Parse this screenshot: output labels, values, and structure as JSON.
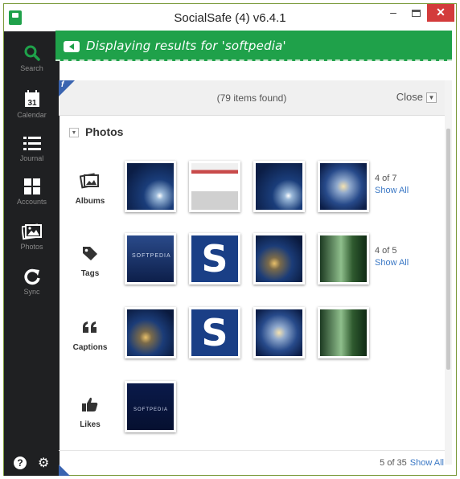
{
  "window": {
    "title": "SocialSafe (4) v6.4.1",
    "min_glyph": "–",
    "close_glyph": "✕"
  },
  "sidebar": {
    "items": [
      {
        "label": "Search",
        "icon": "search-icon",
        "color": "#1fa14a"
      },
      {
        "label": "Calendar",
        "icon": "calendar-icon",
        "day": "31"
      },
      {
        "label": "Journal",
        "icon": "list-icon"
      },
      {
        "label": "Accounts",
        "icon": "grid-icon"
      },
      {
        "label": "Photos",
        "icon": "photos-icon"
      },
      {
        "label": "Sync",
        "icon": "sync-icon"
      }
    ],
    "help_glyph": "?",
    "settings_glyph": "⚙"
  },
  "banner": {
    "text": "Displaying results for 'softpedia'",
    "color": "#1fa14a"
  },
  "results": {
    "items_found": "(79 items found)",
    "close_label": "Close",
    "fb_glyph": "f"
  },
  "photos": {
    "section_title": "Photos",
    "rows": [
      {
        "label": "Albums",
        "count": "4 of 7",
        "show_all": "Show All"
      },
      {
        "label": "Tags",
        "count": "4 of 5",
        "show_all": "Show All"
      },
      {
        "label": "Captions"
      },
      {
        "label": "Likes"
      }
    ],
    "thumb_s_letter": "S"
  },
  "footer": {
    "count": "5 of 35",
    "show_all": "Show All"
  }
}
